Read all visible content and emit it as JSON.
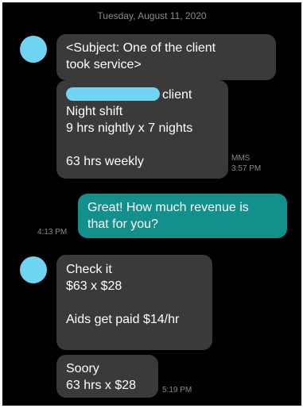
{
  "date_header": "Tuesday, August 11, 2020",
  "colors": {
    "background": "#000000",
    "incoming_bubble": "#3a3a3a",
    "outgoing_bubble": "#138f8c",
    "avatar": "#6fd3f2",
    "meta_text": "#8a8a8a"
  },
  "messages": [
    {
      "direction": "incoming",
      "lines": [
        "<Subject: One of the client",
        "took service>"
      ]
    },
    {
      "direction": "incoming",
      "redacted_name": true,
      "lines": [
        "client",
        "Night shift",
        "9 hrs nightly x 7 nights",
        "",
        "63 hrs weekly"
      ],
      "type_label": "MMS",
      "time": "3:57 PM"
    },
    {
      "direction": "outgoing",
      "lines": [
        "Great! How much revenue is",
        "that for you?"
      ],
      "time": "4:13 PM"
    },
    {
      "direction": "incoming",
      "lines": [
        "Check it",
        "$63 x $28",
        "",
        "Aids get paid $14/hr"
      ]
    },
    {
      "direction": "incoming",
      "lines": [
        "Soory",
        "63 hrs x $28"
      ],
      "time": "5:19 PM"
    }
  ]
}
